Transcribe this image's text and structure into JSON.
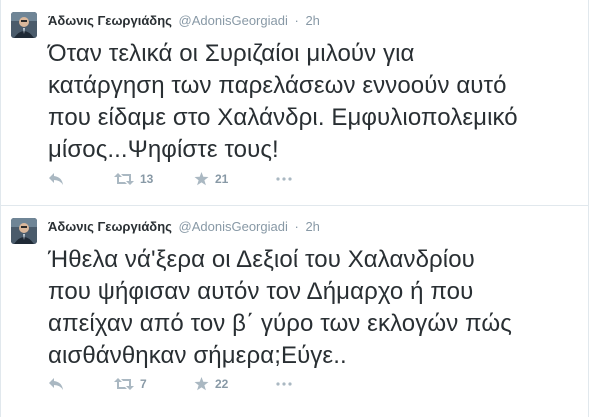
{
  "tweets": [
    {
      "fullname": "Άδωνις Γεωργιάδης",
      "username": "@AdonisGeorgiadi",
      "separator": "·",
      "time": "2h",
      "lines": [
        "Όταν τελικά οι Συριζαίοι μιλούν για",
        "κατάργηση των παρελάσεων εννοούν αυτό",
        "που είδαμε στο Χαλάνδρι. Εμφυλιοπολεμικό",
        "μίσος...Ψηφίστε τους!"
      ],
      "retweets": "13",
      "favorites": "21"
    },
    {
      "fullname": "Άδωνις Γεωργιάδης",
      "username": "@AdonisGeorgiadi",
      "separator": "·",
      "time": "2h",
      "lines": [
        "Ήθελα νά'ξερα οι Δεξιοί του Χαλανδρίου",
        "που ψήφισαν αυτόν τον Δήμαρχο ή που",
        "απείχαν από τον β΄ γύρο των εκλογών πώς",
        "αισθάνθηκαν σήμερα;Εύγε.."
      ],
      "retweets": "7",
      "favorites": "22"
    }
  ],
  "icons": {
    "reply": "reply-icon",
    "retweet": "retweet-icon",
    "favorite": "star-icon",
    "more": "more-icon"
  },
  "colors": {
    "text": "#292f33",
    "meta": "#8899a6",
    "icon": "#aab8c2",
    "border": "#e1e8ed"
  }
}
